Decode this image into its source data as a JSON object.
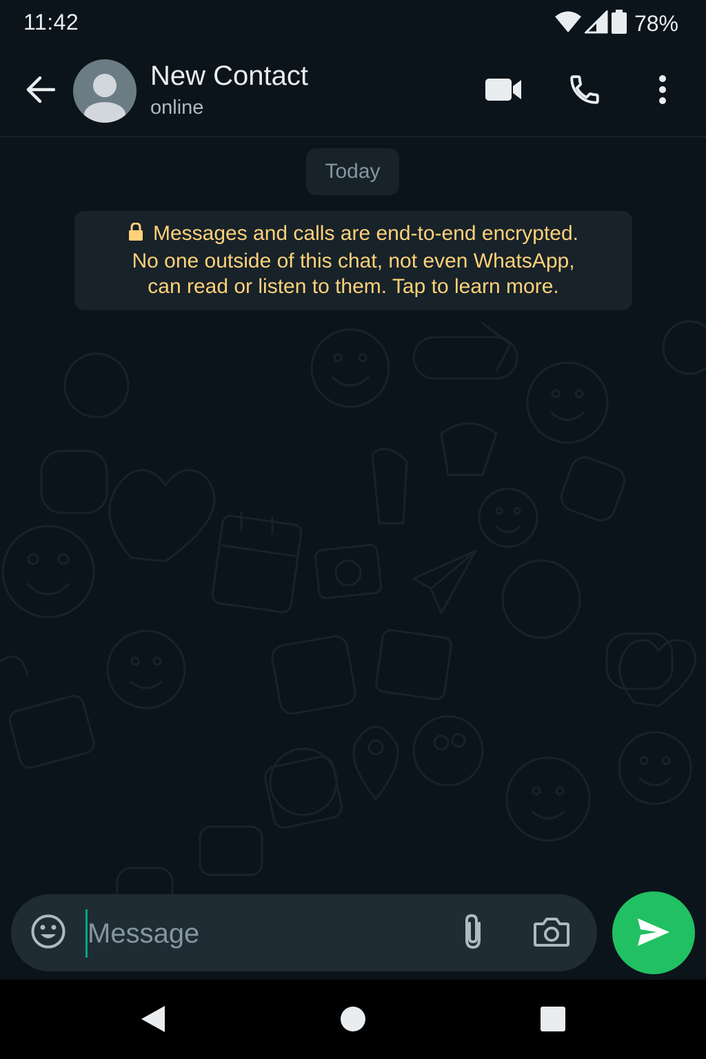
{
  "status_bar": {
    "time": "11:42",
    "battery_percent": "78%",
    "icons": [
      "wifi-icon",
      "signal-icon",
      "battery-icon"
    ]
  },
  "header": {
    "contact_name": "New Contact",
    "contact_status": "online",
    "icons": [
      "back-arrow-icon",
      "default-avatar-icon",
      "video-call-icon",
      "phone-icon",
      "more-vert-icon"
    ]
  },
  "chat": {
    "date_label": "Today",
    "encryption_notice": {
      "line1": "Messages and calls are end-to-end encrypted.",
      "line2": "No one outside of this chat, not even WhatsApp,",
      "line3": "can read or listen to them. Tap to learn more.",
      "icon": "lock-icon"
    }
  },
  "composer": {
    "placeholder": "Message",
    "value": "",
    "icons": [
      "emoji-icon",
      "paperclip-icon",
      "camera-icon",
      "send-icon"
    ]
  },
  "nav_bar": {
    "icons": [
      "nav-back-icon",
      "nav-home-icon",
      "nav-recents-icon"
    ]
  },
  "colors": {
    "background": "#0b141a",
    "header": "#0b141a",
    "bubble_system": "#182229",
    "notice_text": "#ffd279",
    "input_bar": "#1f2c33",
    "accent": "#21c063",
    "cursor": "#00a884",
    "secondary_text": "#8696a0"
  }
}
